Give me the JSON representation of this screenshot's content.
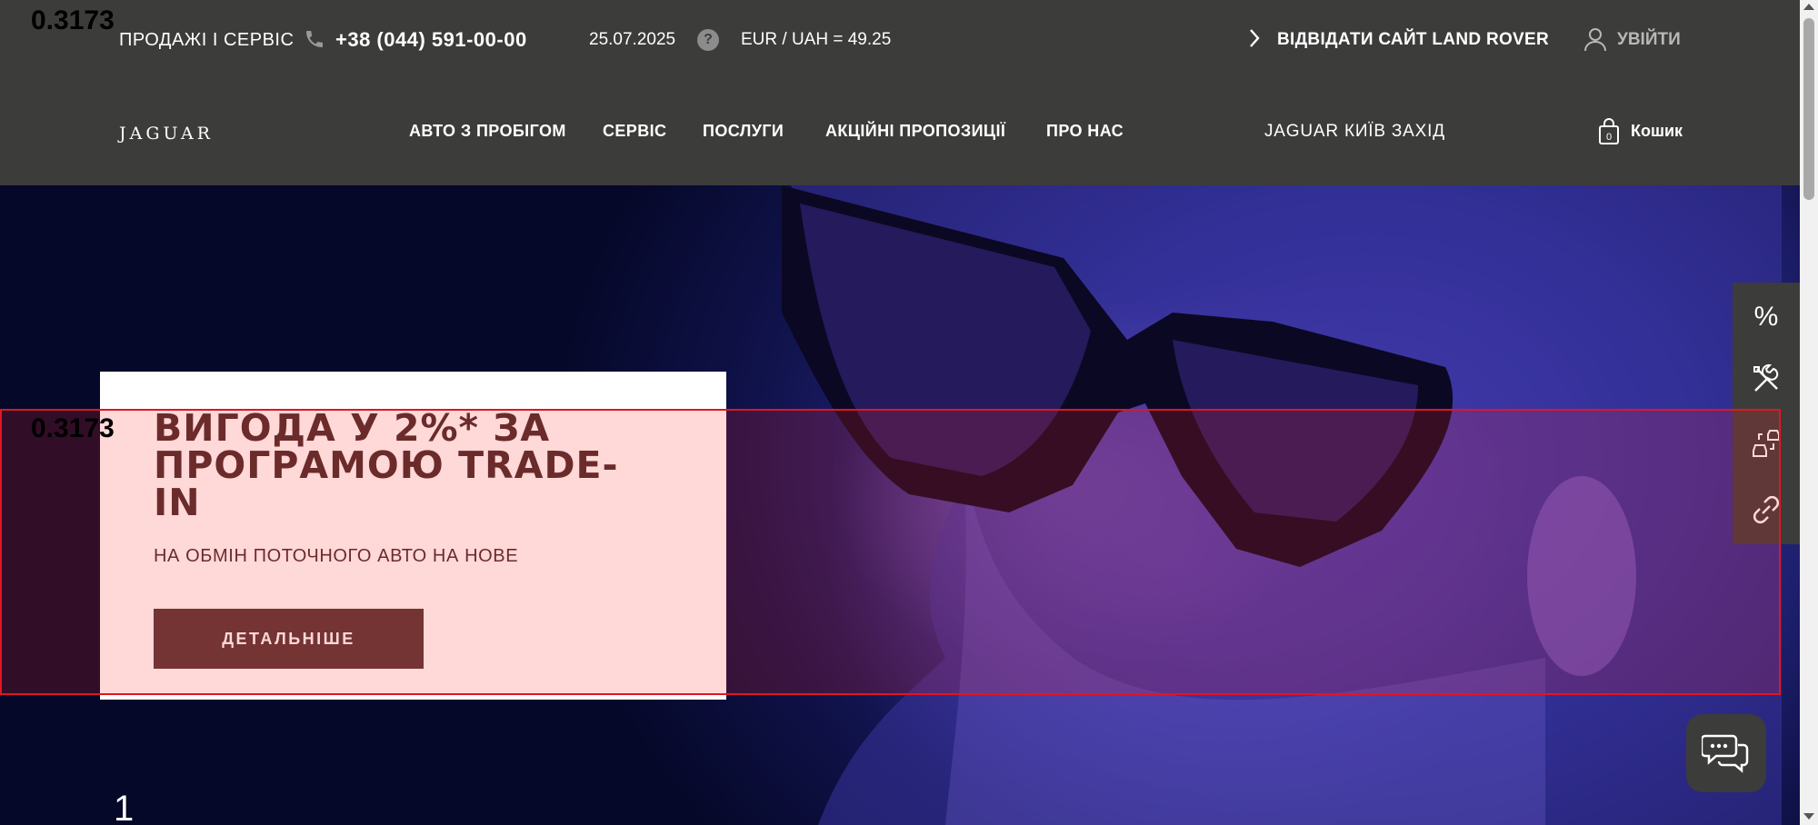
{
  "topbar": {
    "sales_label": "ПРОДАЖІ І СЕРВІС",
    "phone": "+38 (044) 591-00-00",
    "date": "25.07.2025",
    "help_glyph": "?",
    "rate": "EUR / UAH = 49.25",
    "visit_label": "ВІДВІДАТИ САЙТ LAND ROVER",
    "login_label": "УВІЙТИ"
  },
  "navbar": {
    "logo": "JAGUAR",
    "items": [
      {
        "label": "АВТО З ПРОБІГОМ"
      },
      {
        "label": "СЕРВІС"
      },
      {
        "label": "ПОСЛУГИ"
      },
      {
        "label": "АКЦІЙНІ ПРОПОЗИЦІЇ"
      },
      {
        "label": "ПРО НАС"
      }
    ],
    "dealer": "JAGUAR КИЇВ ЗАХІД",
    "cart_label": "Кошик",
    "cart_count": "0"
  },
  "hero": {
    "title": "ВИГОДА У 2%* ЗА ПРОГРАМОЮ TRADE-IN",
    "subtitle": "НА ОБМІН ПОТОЧНОГО АВТО НА НОВЕ",
    "button_label": "ДЕТАЛЬНІШЕ",
    "slide_number": "1"
  },
  "overlay": {
    "score_top": "0.3173",
    "score_box": "0.3173",
    "highlight_color": "#e01622"
  },
  "side_tools": {
    "percent_glyph": "%",
    "icons": [
      "percent-icon",
      "wrench-tools-icon",
      "car-exchange-icon",
      "link-icon"
    ]
  },
  "colors": {
    "header_bg": "#3c3c3b",
    "button_bg": "#553836",
    "title_color": "#4b2d2d"
  }
}
